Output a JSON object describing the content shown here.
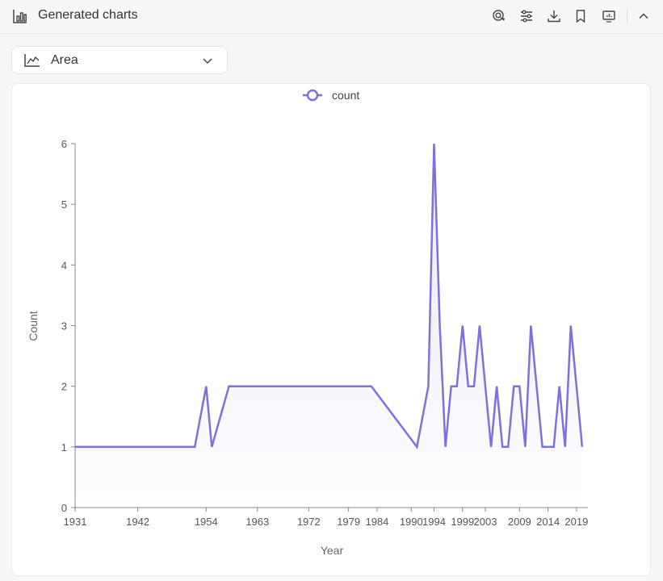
{
  "header": {
    "title": "Generated charts",
    "icons": [
      "bar-chart-icon",
      "target-icon",
      "sliders-icon",
      "download-icon",
      "bookmark-icon",
      "presentation-icon",
      "chevron-up-icon"
    ]
  },
  "chart_type_select": {
    "selected": "Area",
    "icon": "area-chart-icon"
  },
  "colors": {
    "series": "#7b72dd",
    "axis": "#8a8a8a",
    "text": "#555555"
  },
  "chart_data": {
    "type": "area",
    "xlabel": "Year",
    "ylabel": "Count",
    "ylim": [
      0,
      6
    ],
    "yticks": [
      0,
      1,
      2,
      3,
      4,
      5,
      6
    ],
    "xticks": [
      "1931",
      "1942",
      "1954",
      "1963",
      "1972",
      "1979",
      "1984",
      "1990",
      "1994",
      "1999",
      "2003",
      "2009",
      "2014",
      "2019"
    ],
    "legend": {
      "position": "top-center",
      "entries": [
        "count"
      ]
    },
    "series": [
      {
        "name": "count",
        "x": [
          1931,
          1952,
          1954,
          1955,
          1958,
          1983,
          1991,
          1993,
          1994,
          1995,
          1996,
          1997,
          1998,
          1999,
          2000,
          2001,
          2002,
          2003,
          2004,
          2005,
          2006,
          2007,
          2008,
          2009,
          2010,
          2011,
          2012,
          2013,
          2014,
          2015,
          2016,
          2017,
          2018,
          2019,
          2020
        ],
        "values": [
          1,
          1,
          2,
          1,
          2,
          2,
          1,
          2,
          6,
          3,
          1,
          2,
          2,
          3,
          2,
          2,
          3,
          2,
          1,
          2,
          1,
          1,
          2,
          2,
          1,
          3,
          2,
          1,
          1,
          1,
          2,
          1,
          3,
          2,
          1
        ]
      }
    ]
  }
}
